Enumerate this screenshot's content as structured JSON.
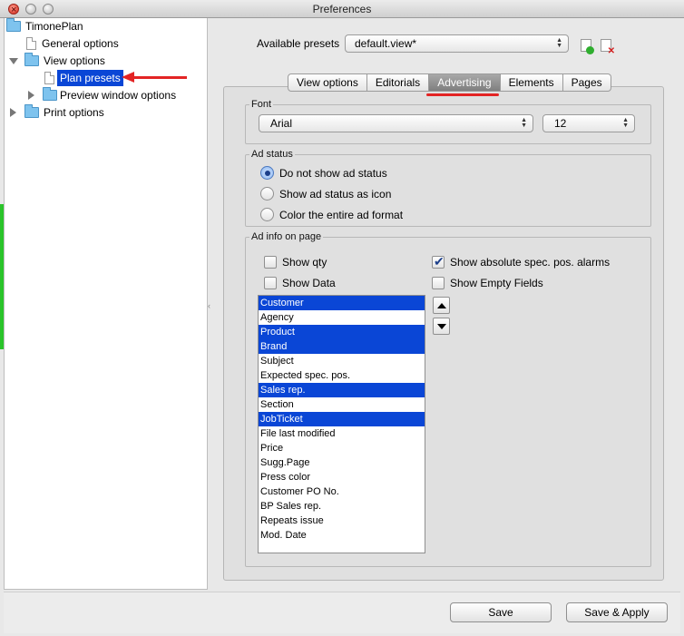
{
  "window": {
    "title": "Preferences"
  },
  "tree": {
    "root": "TimonePlan",
    "general": "General options",
    "view": "View options",
    "plan_presets": "Plan presets",
    "preview": "Preview window options",
    "print": "Print options"
  },
  "presets": {
    "label": "Available presets",
    "value": "default.view*"
  },
  "tabs": [
    "View options",
    "Editorials",
    "Advertising",
    "Elements",
    "Pages"
  ],
  "active_tab": "Advertising",
  "font": {
    "legend": "Font",
    "family": "Arial",
    "size": "12"
  },
  "ad_status": {
    "legend": "Ad status",
    "options": [
      "Do not show ad status",
      "Show ad status as icon",
      "Color the entire ad format"
    ],
    "selected_index": 0
  },
  "ad_info": {
    "legend": "Ad info on page",
    "show_qty": "Show qty",
    "show_data": "Show Data",
    "show_alarms": "Show absolute spec. pos. alarms",
    "show_empty": "Show Empty Fields",
    "fields": [
      "Customer",
      "Agency",
      "Product",
      "Brand",
      "Subject",
      "Expected spec. pos.",
      "Sales rep.",
      "Section",
      "JobTicket",
      "File last modified",
      "Price",
      "Sugg.Page",
      "Press color",
      "Customer PO No.",
      "BP Sales rep.",
      "Repeats issue",
      "Mod. Date"
    ],
    "selected_fields": [
      "Customer",
      "Product",
      "Brand",
      "Sales rep.",
      "JobTicket"
    ]
  },
  "buttons": {
    "save": "Save",
    "save_apply": "Save & Apply"
  },
  "colors": {
    "selection": "#0a46d6",
    "annotation_red": "#e32424"
  }
}
